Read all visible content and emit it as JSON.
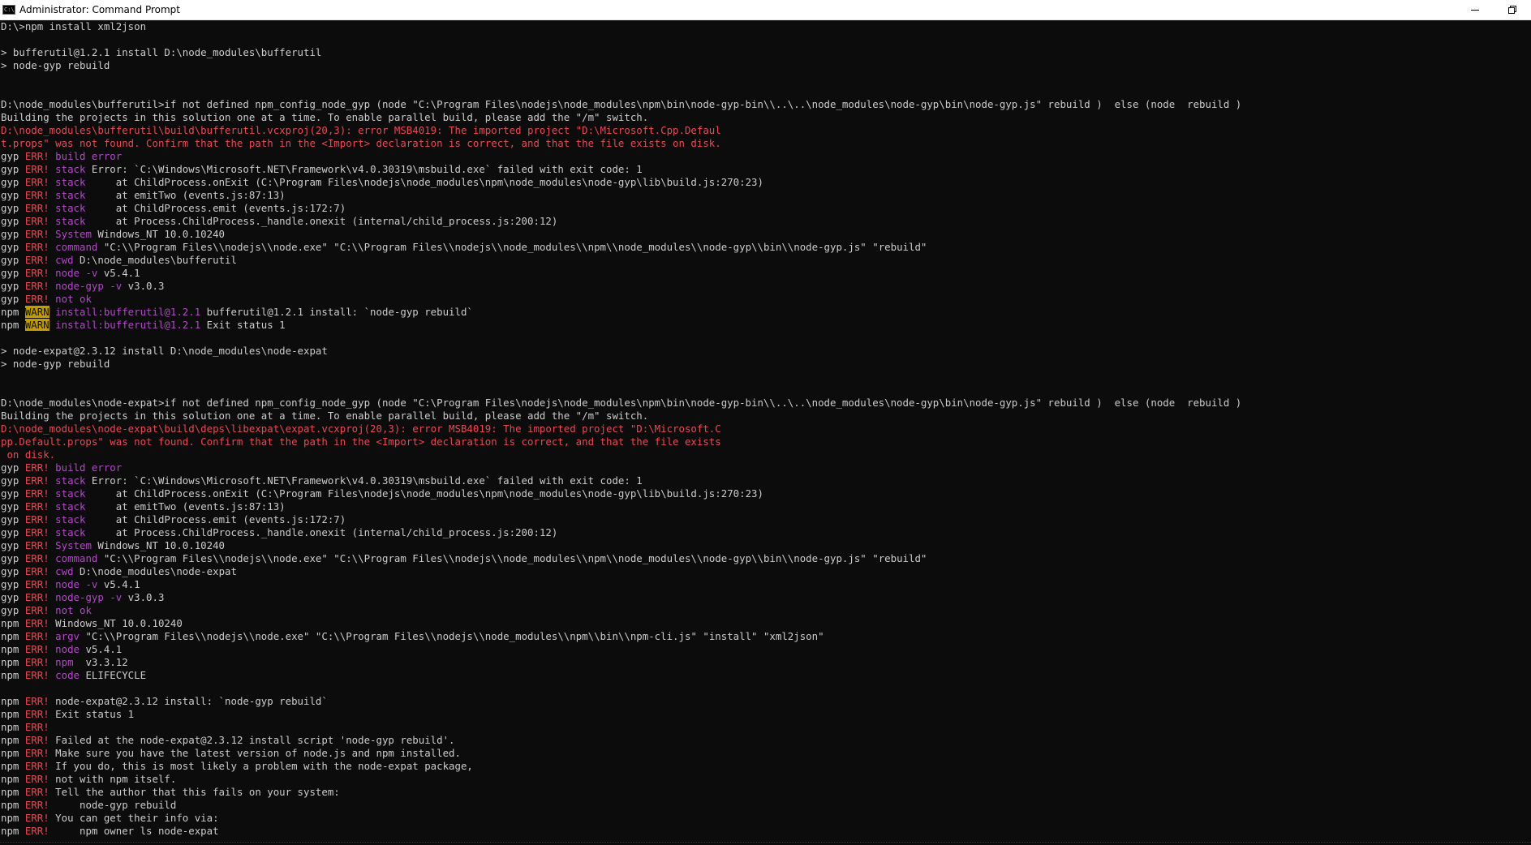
{
  "window": {
    "title": "Administrator: Command Prompt",
    "app_icon_text": "C:\\"
  },
  "colors": {
    "background": "#0c0c0c",
    "default_text": "#cccccc",
    "error_red": "#e74856",
    "err_magenta": "#b148c6",
    "warn_bg": "#c19c00"
  },
  "console": {
    "lines": [
      [
        [
          "d",
          "D:\\>npm install xml2json"
        ]
      ],
      [],
      [
        [
          "d",
          "> bufferutil@1.2.1 install D:\\node_modules\\bufferutil"
        ]
      ],
      [
        [
          "d",
          "> node-gyp rebuild"
        ]
      ],
      [],
      [],
      [
        [
          "d",
          "D:\\node_modules\\bufferutil>if not defined npm_config_node_gyp (node \"C:\\Program Files\\nodejs\\node_modules\\npm\\bin\\node-gyp-bin\\\\..\\..\\node_modules\\node-gyp\\bin\\node-gyp.js\" rebuild )  else (node  rebuild )"
        ]
      ],
      [
        [
          "d",
          "Building the projects in this solution one at a time. To enable parallel build, please add the \"/m\" switch."
        ]
      ],
      [
        [
          "r",
          "D:\\node_modules\\bufferutil\\build\\bufferutil.vcxproj(20,3): error MSB4019: The imported project \"D:\\Microsoft.Cpp.Defaul"
        ]
      ],
      [
        [
          "r",
          "t.props\" was not found. Confirm that the path in the <Import> declaration is correct, and that the file exists on disk."
        ]
      ],
      [
        [
          "d",
          "gyp "
        ],
        [
          "r",
          "ERR!"
        ],
        [
          "m",
          " build error"
        ]
      ],
      [
        [
          "d",
          "gyp "
        ],
        [
          "r",
          "ERR!"
        ],
        [
          "m",
          " stack"
        ],
        [
          "d",
          " Error: `C:\\Windows\\Microsoft.NET\\Framework\\v4.0.30319\\msbuild.exe` failed with exit code: 1"
        ]
      ],
      [
        [
          "d",
          "gyp "
        ],
        [
          "r",
          "ERR!"
        ],
        [
          "m",
          " stack"
        ],
        [
          "d",
          "     at ChildProcess.onExit (C:\\Program Files\\nodejs\\node_modules\\npm\\node_modules\\node-gyp\\lib\\build.js:270:23)"
        ]
      ],
      [
        [
          "d",
          "gyp "
        ],
        [
          "r",
          "ERR!"
        ],
        [
          "m",
          " stack"
        ],
        [
          "d",
          "     at emitTwo (events.js:87:13)"
        ]
      ],
      [
        [
          "d",
          "gyp "
        ],
        [
          "r",
          "ERR!"
        ],
        [
          "m",
          " stack"
        ],
        [
          "d",
          "     at ChildProcess.emit (events.js:172:7)"
        ]
      ],
      [
        [
          "d",
          "gyp "
        ],
        [
          "r",
          "ERR!"
        ],
        [
          "m",
          " stack"
        ],
        [
          "d",
          "     at Process.ChildProcess._handle.onexit (internal/child_process.js:200:12)"
        ]
      ],
      [
        [
          "d",
          "gyp "
        ],
        [
          "r",
          "ERR!"
        ],
        [
          "m",
          " System"
        ],
        [
          "d",
          " Windows_NT 10.0.10240"
        ]
      ],
      [
        [
          "d",
          "gyp "
        ],
        [
          "r",
          "ERR!"
        ],
        [
          "m",
          " command"
        ],
        [
          "d",
          " \"C:\\\\Program Files\\\\nodejs\\\\node.exe\" \"C:\\\\Program Files\\\\nodejs\\\\node_modules\\\\npm\\\\node_modules\\\\node-gyp\\\\bin\\\\node-gyp.js\" \"rebuild\""
        ]
      ],
      [
        [
          "d",
          "gyp "
        ],
        [
          "r",
          "ERR!"
        ],
        [
          "m",
          " cwd"
        ],
        [
          "d",
          " D:\\node_modules\\bufferutil"
        ]
      ],
      [
        [
          "d",
          "gyp "
        ],
        [
          "r",
          "ERR!"
        ],
        [
          "m",
          " node -v"
        ],
        [
          "d",
          " v5.4.1"
        ]
      ],
      [
        [
          "d",
          "gyp "
        ],
        [
          "r",
          "ERR!"
        ],
        [
          "m",
          " node-gyp -v"
        ],
        [
          "d",
          " v3.0.3"
        ]
      ],
      [
        [
          "d",
          "gyp "
        ],
        [
          "r",
          "ERR!"
        ],
        [
          "m",
          " not ok"
        ]
      ],
      [
        [
          "d",
          "npm "
        ],
        [
          "w",
          "WARN"
        ],
        [
          "m",
          " install:bufferutil@1.2.1"
        ],
        [
          "d",
          " bufferutil@1.2.1 install: `node-gyp rebuild`"
        ]
      ],
      [
        [
          "d",
          "npm "
        ],
        [
          "w",
          "WARN"
        ],
        [
          "m",
          " install:bufferutil@1.2.1"
        ],
        [
          "d",
          " Exit status 1"
        ]
      ],
      [],
      [
        [
          "d",
          "> node-expat@2.3.12 install D:\\node_modules\\node-expat"
        ]
      ],
      [
        [
          "d",
          "> node-gyp rebuild"
        ]
      ],
      [],
      [],
      [
        [
          "d",
          "D:\\node_modules\\node-expat>if not defined npm_config_node_gyp (node \"C:\\Program Files\\nodejs\\node_modules\\npm\\bin\\node-gyp-bin\\\\..\\..\\node_modules\\node-gyp\\bin\\node-gyp.js\" rebuild )  else (node  rebuild )"
        ]
      ],
      [
        [
          "d",
          "Building the projects in this solution one at a time. To enable parallel build, please add the \"/m\" switch."
        ]
      ],
      [
        [
          "r",
          "D:\\node_modules\\node-expat\\build\\deps\\libexpat\\expat.vcxproj(20,3): error MSB4019: The imported project \"D:\\Microsoft.C"
        ]
      ],
      [
        [
          "r",
          "pp.Default.props\" was not found. Confirm that the path in the <Import> declaration is correct, and that the file exists"
        ]
      ],
      [
        [
          "r",
          " on disk."
        ]
      ],
      [
        [
          "d",
          "gyp "
        ],
        [
          "r",
          "ERR!"
        ],
        [
          "m",
          " build error"
        ]
      ],
      [
        [
          "d",
          "gyp "
        ],
        [
          "r",
          "ERR!"
        ],
        [
          "m",
          " stack"
        ],
        [
          "d",
          " Error: `C:\\Windows\\Microsoft.NET\\Framework\\v4.0.30319\\msbuild.exe` failed with exit code: 1"
        ]
      ],
      [
        [
          "d",
          "gyp "
        ],
        [
          "r",
          "ERR!"
        ],
        [
          "m",
          " stack"
        ],
        [
          "d",
          "     at ChildProcess.onExit (C:\\Program Files\\nodejs\\node_modules\\npm\\node_modules\\node-gyp\\lib\\build.js:270:23)"
        ]
      ],
      [
        [
          "d",
          "gyp "
        ],
        [
          "r",
          "ERR!"
        ],
        [
          "m",
          " stack"
        ],
        [
          "d",
          "     at emitTwo (events.js:87:13)"
        ]
      ],
      [
        [
          "d",
          "gyp "
        ],
        [
          "r",
          "ERR!"
        ],
        [
          "m",
          " stack"
        ],
        [
          "d",
          "     at ChildProcess.emit (events.js:172:7)"
        ]
      ],
      [
        [
          "d",
          "gyp "
        ],
        [
          "r",
          "ERR!"
        ],
        [
          "m",
          " stack"
        ],
        [
          "d",
          "     at Process.ChildProcess._handle.onexit (internal/child_process.js:200:12)"
        ]
      ],
      [
        [
          "d",
          "gyp "
        ],
        [
          "r",
          "ERR!"
        ],
        [
          "m",
          " System"
        ],
        [
          "d",
          " Windows_NT 10.0.10240"
        ]
      ],
      [
        [
          "d",
          "gyp "
        ],
        [
          "r",
          "ERR!"
        ],
        [
          "m",
          " command"
        ],
        [
          "d",
          " \"C:\\\\Program Files\\\\nodejs\\\\node.exe\" \"C:\\\\Program Files\\\\nodejs\\\\node_modules\\\\npm\\\\node_modules\\\\node-gyp\\\\bin\\\\node-gyp.js\" \"rebuild\""
        ]
      ],
      [
        [
          "d",
          "gyp "
        ],
        [
          "r",
          "ERR!"
        ],
        [
          "m",
          " cwd"
        ],
        [
          "d",
          " D:\\node_modules\\node-expat"
        ]
      ],
      [
        [
          "d",
          "gyp "
        ],
        [
          "r",
          "ERR!"
        ],
        [
          "m",
          " node -v"
        ],
        [
          "d",
          " v5.4.1"
        ]
      ],
      [
        [
          "d",
          "gyp "
        ],
        [
          "r",
          "ERR!"
        ],
        [
          "m",
          " node-gyp -v"
        ],
        [
          "d",
          " v3.0.3"
        ]
      ],
      [
        [
          "d",
          "gyp "
        ],
        [
          "r",
          "ERR!"
        ],
        [
          "m",
          " not ok"
        ]
      ],
      [
        [
          "d",
          "npm "
        ],
        [
          "r",
          "ERR!"
        ],
        [
          "d",
          " Windows_NT 10.0.10240"
        ]
      ],
      [
        [
          "d",
          "npm "
        ],
        [
          "r",
          "ERR!"
        ],
        [
          "m",
          " argv"
        ],
        [
          "d",
          " \"C:\\\\Program Files\\\\nodejs\\\\node.exe\" \"C:\\\\Program Files\\\\nodejs\\\\node_modules\\\\npm\\\\bin\\\\npm-cli.js\" \"install\" \"xml2json\""
        ]
      ],
      [
        [
          "d",
          "npm "
        ],
        [
          "r",
          "ERR!"
        ],
        [
          "m",
          " node"
        ],
        [
          "d",
          " v5.4.1"
        ]
      ],
      [
        [
          "d",
          "npm "
        ],
        [
          "r",
          "ERR!"
        ],
        [
          "m",
          " npm "
        ],
        [
          "d",
          " v3.3.12"
        ]
      ],
      [
        [
          "d",
          "npm "
        ],
        [
          "r",
          "ERR!"
        ],
        [
          "m",
          " code"
        ],
        [
          "d",
          " ELIFECYCLE"
        ]
      ],
      [],
      [
        [
          "d",
          "npm "
        ],
        [
          "r",
          "ERR!"
        ],
        [
          "d",
          " node-expat@2.3.12 install: `node-gyp rebuild`"
        ]
      ],
      [
        [
          "d",
          "npm "
        ],
        [
          "r",
          "ERR!"
        ],
        [
          "d",
          " Exit status 1"
        ]
      ],
      [
        [
          "d",
          "npm "
        ],
        [
          "r",
          "ERR!"
        ]
      ],
      [
        [
          "d",
          "npm "
        ],
        [
          "r",
          "ERR!"
        ],
        [
          "d",
          " Failed at the node-expat@2.3.12 install script 'node-gyp rebuild'."
        ]
      ],
      [
        [
          "d",
          "npm "
        ],
        [
          "r",
          "ERR!"
        ],
        [
          "d",
          " Make sure you have the latest version of node.js and npm installed."
        ]
      ],
      [
        [
          "d",
          "npm "
        ],
        [
          "r",
          "ERR!"
        ],
        [
          "d",
          " If you do, this is most likely a problem with the node-expat package,"
        ]
      ],
      [
        [
          "d",
          "npm "
        ],
        [
          "r",
          "ERR!"
        ],
        [
          "d",
          " not with npm itself."
        ]
      ],
      [
        [
          "d",
          "npm "
        ],
        [
          "r",
          "ERR!"
        ],
        [
          "d",
          " Tell the author that this fails on your system:"
        ]
      ],
      [
        [
          "d",
          "npm "
        ],
        [
          "r",
          "ERR!"
        ],
        [
          "d",
          "     node-gyp rebuild"
        ]
      ],
      [
        [
          "d",
          "npm "
        ],
        [
          "r",
          "ERR!"
        ],
        [
          "d",
          " You can get their info via:"
        ]
      ],
      [
        [
          "d",
          "npm "
        ],
        [
          "r",
          "ERR!"
        ],
        [
          "d",
          "     npm owner ls node-expat"
        ]
      ]
    ]
  }
}
